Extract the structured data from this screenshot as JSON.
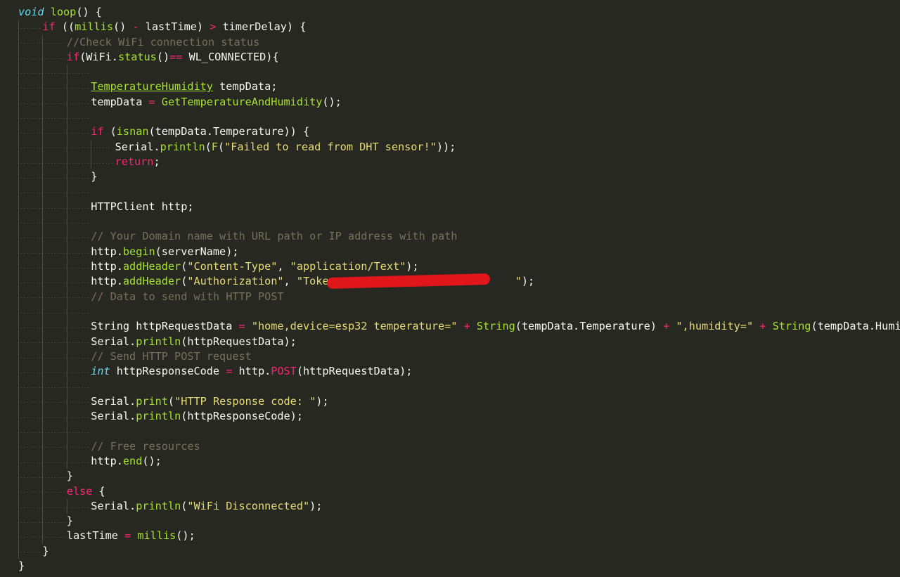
{
  "editor": {
    "language": "C++ (Arduino)",
    "theme": {
      "background": "#272822",
      "keyword": "#f92672",
      "type": "#66d9ef",
      "function": "#a6e22e",
      "string": "#e6db74",
      "comment": "#75715e",
      "plain": "#f8f8f2"
    },
    "lines": [
      {
        "indent": 0,
        "tokens": [
          {
            "t": "ty",
            "v": "void"
          },
          {
            "t": "pl",
            "v": " "
          },
          {
            "t": "fn",
            "v": "loop"
          },
          {
            "t": "pl",
            "v": "() {"
          }
        ]
      },
      {
        "indent": 1,
        "tokens": [
          {
            "t": "kw",
            "v": "if"
          },
          {
            "t": "pl",
            "v": " (("
          },
          {
            "t": "fn",
            "v": "millis"
          },
          {
            "t": "pl",
            "v": "() "
          },
          {
            "t": "op",
            "v": "-"
          },
          {
            "t": "pl",
            "v": " lastTime) "
          },
          {
            "t": "op",
            "v": ">"
          },
          {
            "t": "pl",
            "v": " timerDelay) {"
          }
        ]
      },
      {
        "indent": 2,
        "tokens": [
          {
            "t": "cm",
            "v": "//Check WiFi connection status"
          }
        ]
      },
      {
        "indent": 2,
        "tokens": [
          {
            "t": "kw",
            "v": "if"
          },
          {
            "t": "pl",
            "v": "(WiFi."
          },
          {
            "t": "fn",
            "v": "status"
          },
          {
            "t": "pl",
            "v": "()"
          },
          {
            "t": "op",
            "v": "=="
          },
          {
            "t": "pl",
            "v": " WL_CONNECTED){"
          }
        ]
      },
      {
        "indent": 3,
        "tokens": []
      },
      {
        "indent": 3,
        "tokens": [
          {
            "t": "cls",
            "v": "TemperatureHumidity"
          },
          {
            "t": "pl",
            "v": " tempData;"
          }
        ]
      },
      {
        "indent": 3,
        "tokens": [
          {
            "t": "pl",
            "v": "tempData "
          },
          {
            "t": "op",
            "v": "="
          },
          {
            "t": "pl",
            "v": " "
          },
          {
            "t": "fn",
            "v": "GetTemperatureAndHumidity"
          },
          {
            "t": "pl",
            "v": "();"
          }
        ]
      },
      {
        "indent": 3,
        "tokens": []
      },
      {
        "indent": 3,
        "tokens": [
          {
            "t": "kw",
            "v": "if"
          },
          {
            "t": "pl",
            "v": " ("
          },
          {
            "t": "fn",
            "v": "isnan"
          },
          {
            "t": "pl",
            "v": "(tempData.Temperature)) {"
          }
        ]
      },
      {
        "indent": 4,
        "tokens": [
          {
            "t": "pl",
            "v": "Serial."
          },
          {
            "t": "fn",
            "v": "println"
          },
          {
            "t": "pl",
            "v": "("
          },
          {
            "t": "fn",
            "v": "F"
          },
          {
            "t": "pl",
            "v": "("
          },
          {
            "t": "str",
            "v": "\"Failed to read from DHT sensor!\""
          },
          {
            "t": "pl",
            "v": "));"
          }
        ]
      },
      {
        "indent": 4,
        "tokens": [
          {
            "t": "kw",
            "v": "return"
          },
          {
            "t": "pl",
            "v": ";"
          }
        ]
      },
      {
        "indent": 3,
        "tokens": [
          {
            "t": "pl",
            "v": "}"
          }
        ]
      },
      {
        "indent": 3,
        "tokens": []
      },
      {
        "indent": 3,
        "tokens": [
          {
            "t": "pl",
            "v": "HTTPClient http;"
          }
        ]
      },
      {
        "indent": 3,
        "tokens": []
      },
      {
        "indent": 3,
        "tokens": [
          {
            "t": "cm",
            "v": "// Your Domain name with URL path or IP address with path"
          }
        ]
      },
      {
        "indent": 3,
        "tokens": [
          {
            "t": "pl",
            "v": "http."
          },
          {
            "t": "fn",
            "v": "begin"
          },
          {
            "t": "pl",
            "v": "(serverName);"
          }
        ]
      },
      {
        "indent": 3,
        "tokens": [
          {
            "t": "pl",
            "v": "http."
          },
          {
            "t": "fn",
            "v": "addHeader"
          },
          {
            "t": "pl",
            "v": "("
          },
          {
            "t": "str",
            "v": "\"Content-Type\""
          },
          {
            "t": "pl",
            "v": ", "
          },
          {
            "t": "str",
            "v": "\"application/Text\""
          },
          {
            "t": "pl",
            "v": ");"
          }
        ]
      },
      {
        "indent": 3,
        "redacted": true,
        "tokens": [
          {
            "t": "pl",
            "v": "http."
          },
          {
            "t": "fn",
            "v": "addHeader"
          },
          {
            "t": "pl",
            "v": "("
          },
          {
            "t": "str",
            "v": "\"Authorization\""
          },
          {
            "t": "pl",
            "v": ", "
          },
          {
            "t": "str",
            "v": "\"Token                            \""
          },
          {
            "t": "pl",
            "v": ");"
          }
        ]
      },
      {
        "indent": 3,
        "tokens": [
          {
            "t": "cm",
            "v": "// Data to send with HTTP POST"
          }
        ]
      },
      {
        "indent": 3,
        "tokens": []
      },
      {
        "indent": 3,
        "tokens": [
          {
            "t": "pl",
            "v": "String httpRequestData "
          },
          {
            "t": "op",
            "v": "="
          },
          {
            "t": "pl",
            "v": " "
          },
          {
            "t": "str",
            "v": "\"home,device=esp32 temperature=\""
          },
          {
            "t": "pl",
            "v": " "
          },
          {
            "t": "op",
            "v": "+"
          },
          {
            "t": "pl",
            "v": " "
          },
          {
            "t": "fn",
            "v": "String"
          },
          {
            "t": "pl",
            "v": "(tempData.Temperature) "
          },
          {
            "t": "op",
            "v": "+"
          },
          {
            "t": "pl",
            "v": " "
          },
          {
            "t": "str",
            "v": "\",humidity=\""
          },
          {
            "t": "pl",
            "v": " "
          },
          {
            "t": "op",
            "v": "+"
          },
          {
            "t": "pl",
            "v": " "
          },
          {
            "t": "fn",
            "v": "String"
          },
          {
            "t": "pl",
            "v": "(tempData.Humidity);"
          }
        ]
      },
      {
        "indent": 3,
        "tokens": [
          {
            "t": "pl",
            "v": "Serial."
          },
          {
            "t": "fn",
            "v": "println"
          },
          {
            "t": "pl",
            "v": "(httpRequestData);"
          }
        ]
      },
      {
        "indent": 3,
        "tokens": [
          {
            "t": "cm",
            "v": "// Send HTTP POST request"
          }
        ]
      },
      {
        "indent": 3,
        "tokens": [
          {
            "t": "ty",
            "v": "int"
          },
          {
            "t": "pl",
            "v": " httpResponseCode "
          },
          {
            "t": "op",
            "v": "="
          },
          {
            "t": "pl",
            "v": " http."
          },
          {
            "t": "kw",
            "v": "POST"
          },
          {
            "t": "pl",
            "v": "(httpRequestData);"
          }
        ]
      },
      {
        "indent": 3,
        "tokens": []
      },
      {
        "indent": 3,
        "tokens": [
          {
            "t": "pl",
            "v": "Serial."
          },
          {
            "t": "fn",
            "v": "print"
          },
          {
            "t": "pl",
            "v": "("
          },
          {
            "t": "str",
            "v": "\"HTTP Response code: \""
          },
          {
            "t": "pl",
            "v": ");"
          }
        ]
      },
      {
        "indent": 3,
        "tokens": [
          {
            "t": "pl",
            "v": "Serial."
          },
          {
            "t": "fn",
            "v": "println"
          },
          {
            "t": "pl",
            "v": "(httpResponseCode);"
          }
        ]
      },
      {
        "indent": 3,
        "tokens": []
      },
      {
        "indent": 3,
        "tokens": [
          {
            "t": "cm",
            "v": "// Free resources"
          }
        ]
      },
      {
        "indent": 3,
        "tokens": [
          {
            "t": "pl",
            "v": "http."
          },
          {
            "t": "fn",
            "v": "end"
          },
          {
            "t": "pl",
            "v": "();"
          }
        ]
      },
      {
        "indent": 2,
        "tokens": [
          {
            "t": "pl",
            "v": "}"
          }
        ]
      },
      {
        "indent": 2,
        "tokens": [
          {
            "t": "kw",
            "v": "else"
          },
          {
            "t": "pl",
            "v": " {"
          }
        ]
      },
      {
        "indent": 3,
        "tokens": [
          {
            "t": "pl",
            "v": "Serial."
          },
          {
            "t": "fn",
            "v": "println"
          },
          {
            "t": "pl",
            "v": "("
          },
          {
            "t": "str",
            "v": "\"WiFi Disconnected\""
          },
          {
            "t": "pl",
            "v": ");"
          }
        ]
      },
      {
        "indent": 2,
        "tokens": [
          {
            "t": "pl",
            "v": "}"
          }
        ]
      },
      {
        "indent": 2,
        "tokens": [
          {
            "t": "pl",
            "v": "lastTime "
          },
          {
            "t": "op",
            "v": "="
          },
          {
            "t": "pl",
            "v": " "
          },
          {
            "t": "fn",
            "v": "millis"
          },
          {
            "t": "pl",
            "v": "();"
          }
        ]
      },
      {
        "indent": 1,
        "tokens": [
          {
            "t": "pl",
            "v": "}"
          }
        ]
      },
      {
        "indent": 0,
        "tokens": [
          {
            "t": "pl",
            "v": "}"
          }
        ]
      }
    ]
  }
}
